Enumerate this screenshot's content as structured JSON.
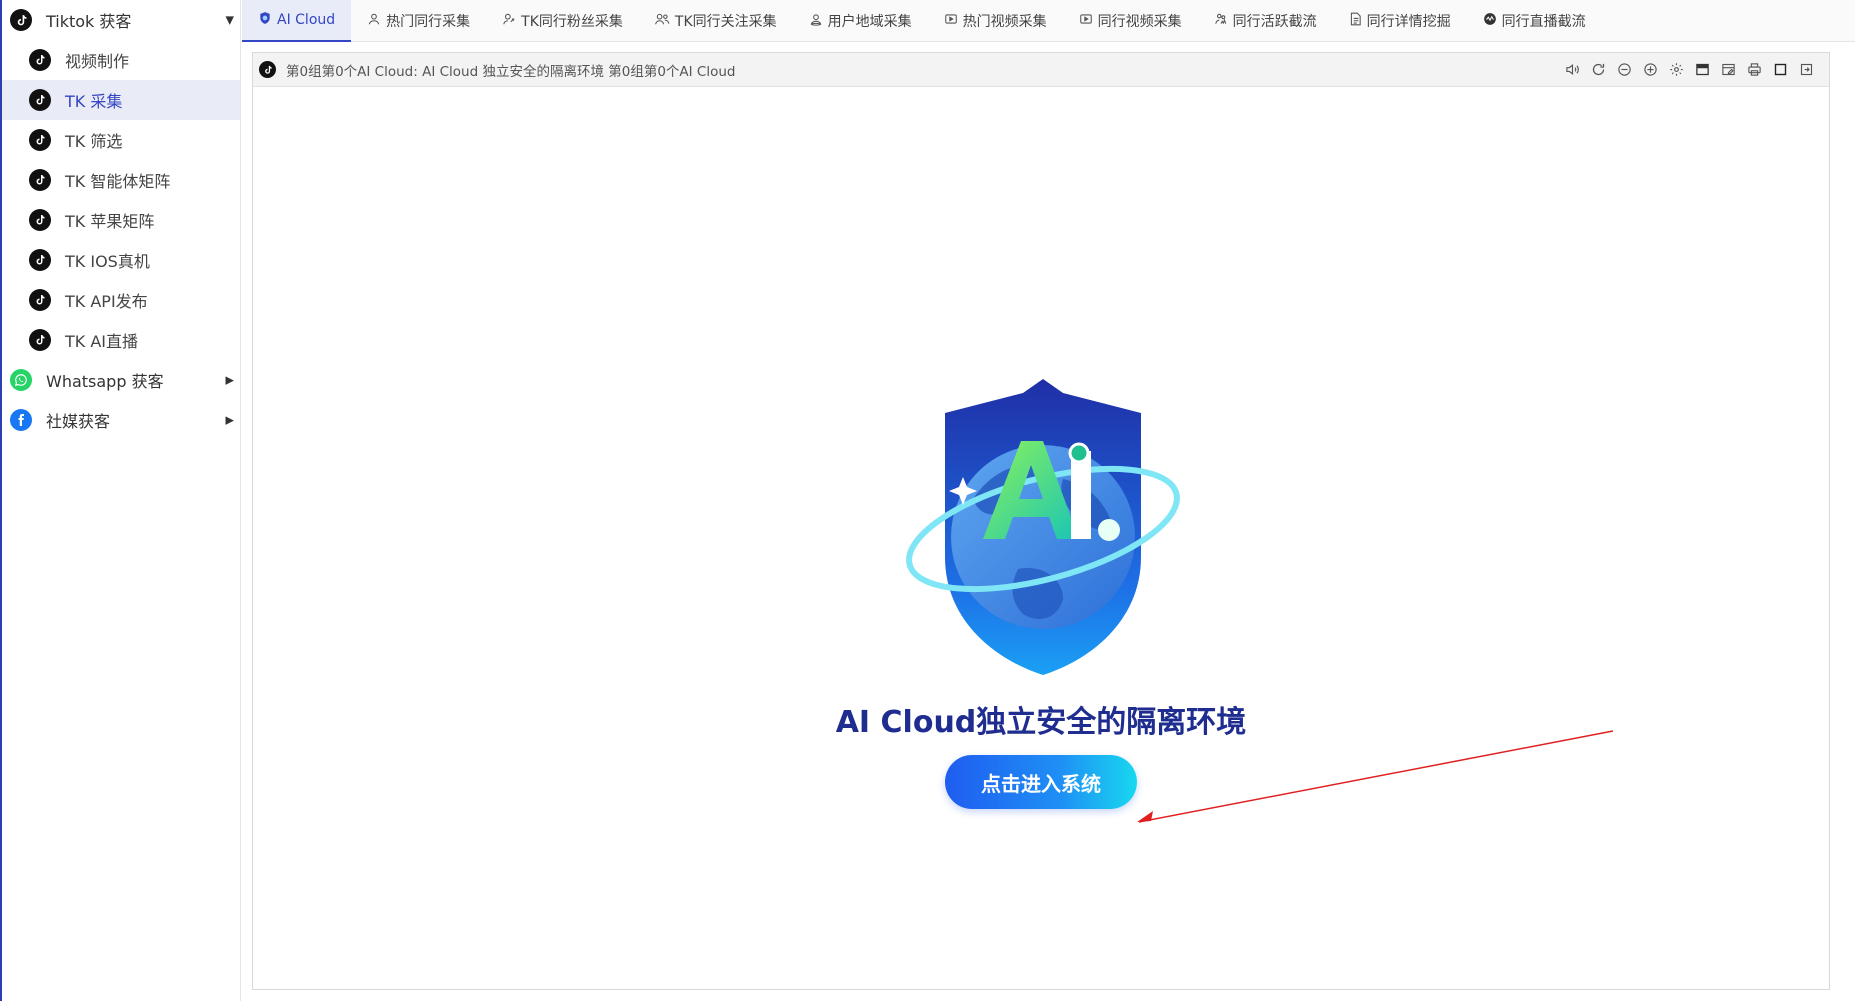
{
  "sidebar": {
    "groups": [
      {
        "label": "Tiktok 获客",
        "icon": "tiktok-icon",
        "expanded": true
      },
      {
        "label": "Whatsapp 获客",
        "icon": "whatsapp-icon",
        "expanded": false
      },
      {
        "label": "社媒获客",
        "icon": "facebook-icon",
        "expanded": false
      }
    ],
    "items": [
      {
        "label": "视频制作",
        "active": false
      },
      {
        "label": "TK 采集",
        "active": true
      },
      {
        "label": "TK 筛选",
        "active": false
      },
      {
        "label": "TK 智能体矩阵",
        "active": false
      },
      {
        "label": "TK 苹果矩阵",
        "active": false
      },
      {
        "label": "TK IOS真机",
        "active": false
      },
      {
        "label": "TK API发布",
        "active": false
      },
      {
        "label": "TK AI直播",
        "active": false
      }
    ]
  },
  "tabs": [
    {
      "label": "AI Cloud",
      "icon": "globe-shield-icon",
      "active": true
    },
    {
      "label": "热门同行采集",
      "icon": "user-icon"
    },
    {
      "label": "TK同行粉丝采集",
      "icon": "user-link-icon"
    },
    {
      "label": "TK同行关注采集",
      "icon": "users-icon"
    },
    {
      "label": "用户地域采集",
      "icon": "location-user-icon"
    },
    {
      "label": "热门视频采集",
      "icon": "video-icon"
    },
    {
      "label": "同行视频采集",
      "icon": "video-icon"
    },
    {
      "label": "同行活跃截流",
      "icon": "users-activity-icon"
    },
    {
      "label": "同行详情挖掘",
      "icon": "document-icon"
    },
    {
      "label": "同行直播截流",
      "icon": "live-icon"
    }
  ],
  "frame": {
    "title": "第0组第0个AI Cloud: AI Cloud 独立安全的隔离环境 第0组第0个AI Cloud",
    "tools": [
      "volume-icon",
      "refresh-icon",
      "zoom-out-icon",
      "zoom-in-icon",
      "settings-icon",
      "window-icon",
      "edit-window-icon",
      "print-icon",
      "maximize-icon",
      "exit-icon"
    ]
  },
  "hero": {
    "title": "AI Cloud独立安全的隔离环境",
    "button_label": "点击进入系统"
  },
  "colors": {
    "accent": "#3446c4",
    "title": "#1e2d8f",
    "button_start": "#1f5df0",
    "button_end": "#18d8ef",
    "annotation_arrow": "#e02020"
  }
}
